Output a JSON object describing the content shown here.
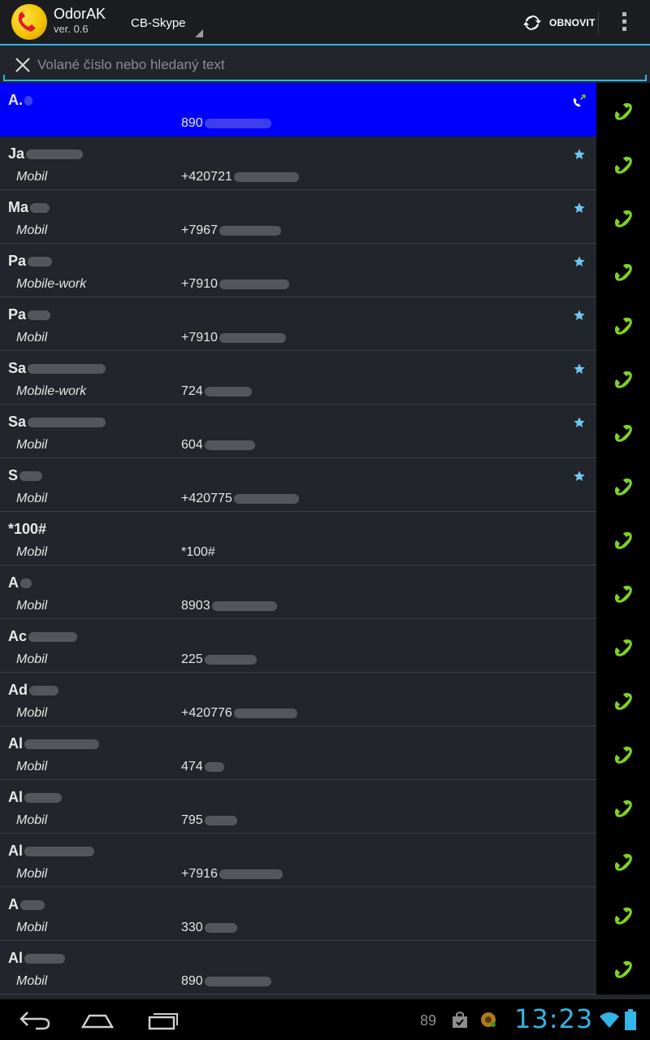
{
  "app": {
    "title": "OdorAK",
    "version": "ver. 0.6"
  },
  "account": {
    "selected": "CB-Skype"
  },
  "actions": {
    "refresh_label": "OBNOVIT"
  },
  "search": {
    "placeholder": "Volané číslo nebo hledaný text",
    "value": ""
  },
  "contacts": [
    {
      "name": "A.",
      "type": "",
      "number": "890",
      "selected": true,
      "icon": "call-forwarded-icon"
    },
    {
      "name": "Ja",
      "type": "Mobil",
      "number": "+420721",
      "icon": "star-icon"
    },
    {
      "name": "Ma",
      "type": "Mobil",
      "number": "+7967",
      "icon": "star-icon"
    },
    {
      "name": "Pa",
      "type": "Mobile-work",
      "number": "+7910",
      "icon": "star-icon"
    },
    {
      "name": "Pa",
      "type": "Mobil",
      "number": "+7910",
      "icon": "star-icon"
    },
    {
      "name": "Sa",
      "type": "Mobile-work",
      "number": "724",
      "icon": "star-icon"
    },
    {
      "name": "Sa",
      "type": "Mobil",
      "number": "604",
      "icon": "star-icon"
    },
    {
      "name": "S",
      "type": "Mobil",
      "number": "+420775",
      "icon": "star-icon"
    },
    {
      "name": "*100#",
      "type": "Mobil",
      "number": "*100#",
      "icon": ""
    },
    {
      "name": "A",
      "type": "Mobil",
      "number": "8903",
      "icon": ""
    },
    {
      "name": "Ac",
      "type": "Mobil",
      "number": "225",
      "icon": ""
    },
    {
      "name": "Ad",
      "type": "Mobil",
      "number": "+420776",
      "icon": ""
    },
    {
      "name": "Al",
      "type": "Mobil",
      "number": "474",
      "icon": ""
    },
    {
      "name": "Al",
      "type": "Mobil",
      "number": "795",
      "icon": ""
    },
    {
      "name": "Al",
      "type": "Mobil",
      "number": "+7916",
      "icon": ""
    },
    {
      "name": "A",
      "type": "Mobil",
      "number": "330",
      "icon": ""
    },
    {
      "name": "Al",
      "type": "Mobil",
      "number": "890",
      "icon": ""
    }
  ],
  "statusbar": {
    "notification_count": "89",
    "time": "13:23"
  },
  "colors": {
    "accent": "#33b5e5",
    "selected_row": "#0000ff",
    "call_green": "#7ed321",
    "star": "#6ec6ef"
  }
}
